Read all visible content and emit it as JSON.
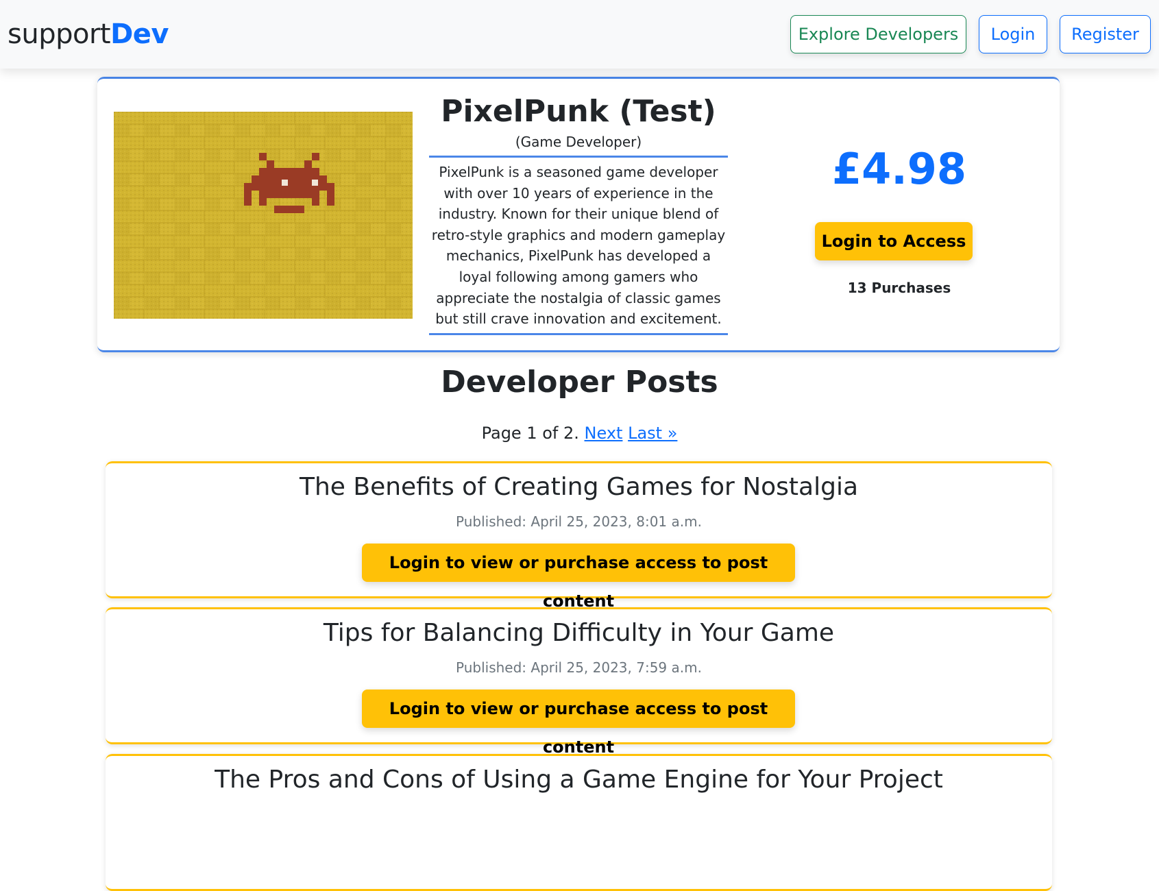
{
  "navbar": {
    "brand_light": "support",
    "brand_strong": "Dev",
    "explore_label": "Explore Developers",
    "login_label": "Login",
    "register_label": "Register"
  },
  "profile": {
    "name": "PixelPunk (Test)",
    "role": "(Game Developer)",
    "bio": "PixelPunk is a seasoned game developer with over 10 years of experience in the industry. Known for their unique blend of retro-style graphics and modern gameplay mechanics, PixelPunk has developed a loyal following among gamers who appreciate the nostalgia of classic games but still crave innovation and excitement.",
    "price": "£4.98",
    "access_label": "Login to Access",
    "purchases": "13 Purchases",
    "image_icon": "space-invader-on-yellow-brick-wall"
  },
  "posts_section": {
    "title": "Developer Posts",
    "page_text": "Page 1 of 2.",
    "next_label": "Next",
    "last_label": "Last »"
  },
  "posts": [
    {
      "title": "The Benefits of Creating Games for Nostalgia",
      "published": "Published: April 25, 2023, 8:01 a.m.",
      "button_label": "Login to view or purchase access to post content"
    },
    {
      "title": "Tips for Balancing Difficulty in Your Game",
      "published": "Published: April 25, 2023, 7:59 a.m.",
      "button_label": "Login to view or purchase access to post content"
    },
    {
      "title": "The Pros and Cons of Using a Game Engine for Your Project",
      "published": "",
      "button_label": ""
    }
  ],
  "colors": {
    "primary": "#0d6efd",
    "success": "#198754",
    "warning": "#ffc107",
    "muted": "#6c757d",
    "card_accent": "#4a86e8"
  }
}
